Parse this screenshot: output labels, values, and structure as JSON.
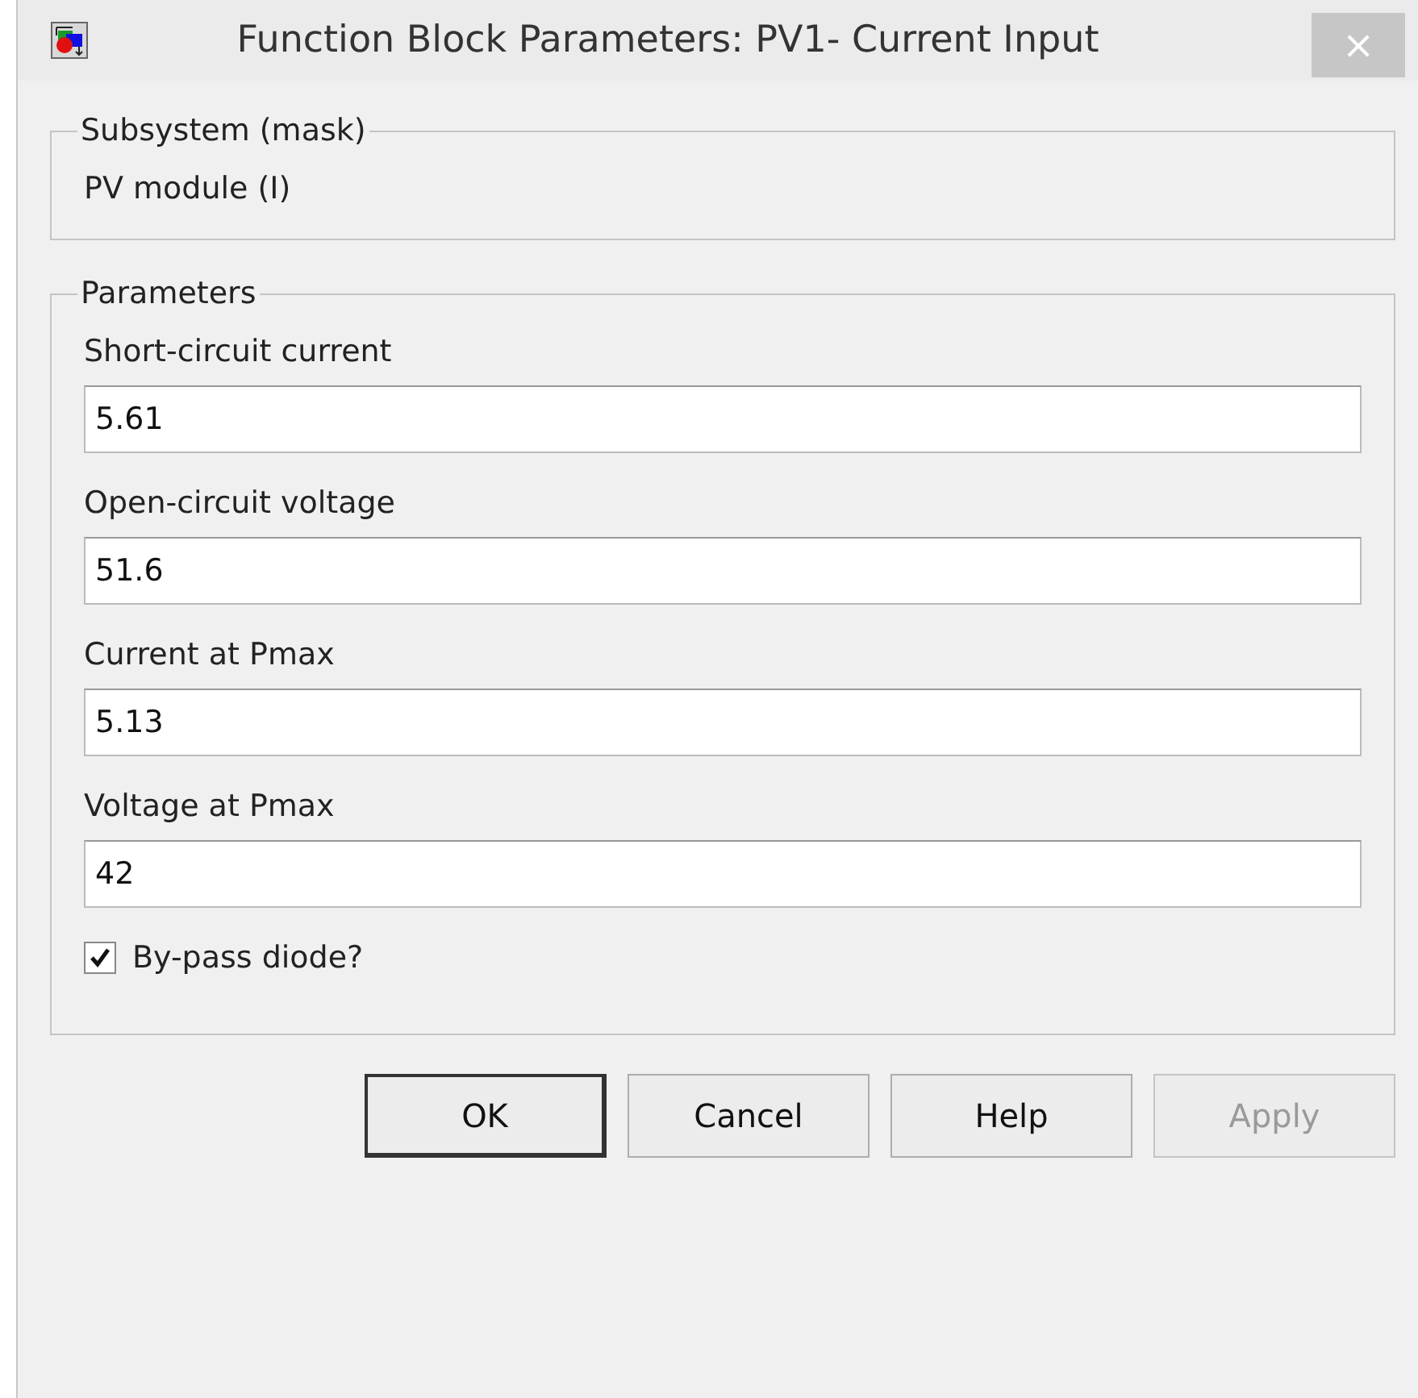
{
  "window": {
    "title": "Function Block Parameters: PV1- Current Input",
    "close": "×"
  },
  "mask_group": {
    "title": "Subsystem (mask)",
    "description": "PV module (I)"
  },
  "parameters_group": {
    "title": "Parameters",
    "fields": [
      {
        "label": "Short-circuit current",
        "value": "5.61"
      },
      {
        "label": "Open-circuit voltage",
        "value": "51.6"
      },
      {
        "label": "Current at Pmax",
        "value": "5.13"
      },
      {
        "label": "Voltage at Pmax",
        "value": "42"
      }
    ],
    "checkbox": {
      "label": "By-pass diode?",
      "checked": true
    }
  },
  "buttons": [
    {
      "label": "OK",
      "default": true,
      "disabled": false
    },
    {
      "label": "Cancel",
      "default": false,
      "disabled": false
    },
    {
      "label": "Help",
      "default": false,
      "disabled": false
    },
    {
      "label": "Apply",
      "default": false,
      "disabled": true
    }
  ]
}
